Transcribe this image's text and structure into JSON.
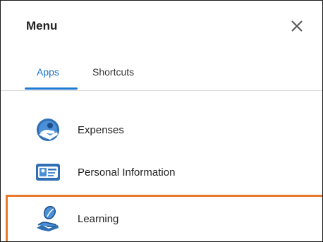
{
  "menu": {
    "title": "Menu"
  },
  "tabs": [
    {
      "label": "Apps",
      "active": true
    },
    {
      "label": "Shortcuts",
      "active": false
    }
  ],
  "apps": [
    {
      "label": "Expenses",
      "icon": "expenses-icon"
    },
    {
      "label": "Personal Information",
      "icon": "id-card-icon"
    },
    {
      "label": "Learning",
      "icon": "learning-icon",
      "highlighted": true
    }
  ],
  "colors": {
    "accent": "#1f7ad4",
    "highlight": "#e87a2c",
    "text": "#222222"
  }
}
